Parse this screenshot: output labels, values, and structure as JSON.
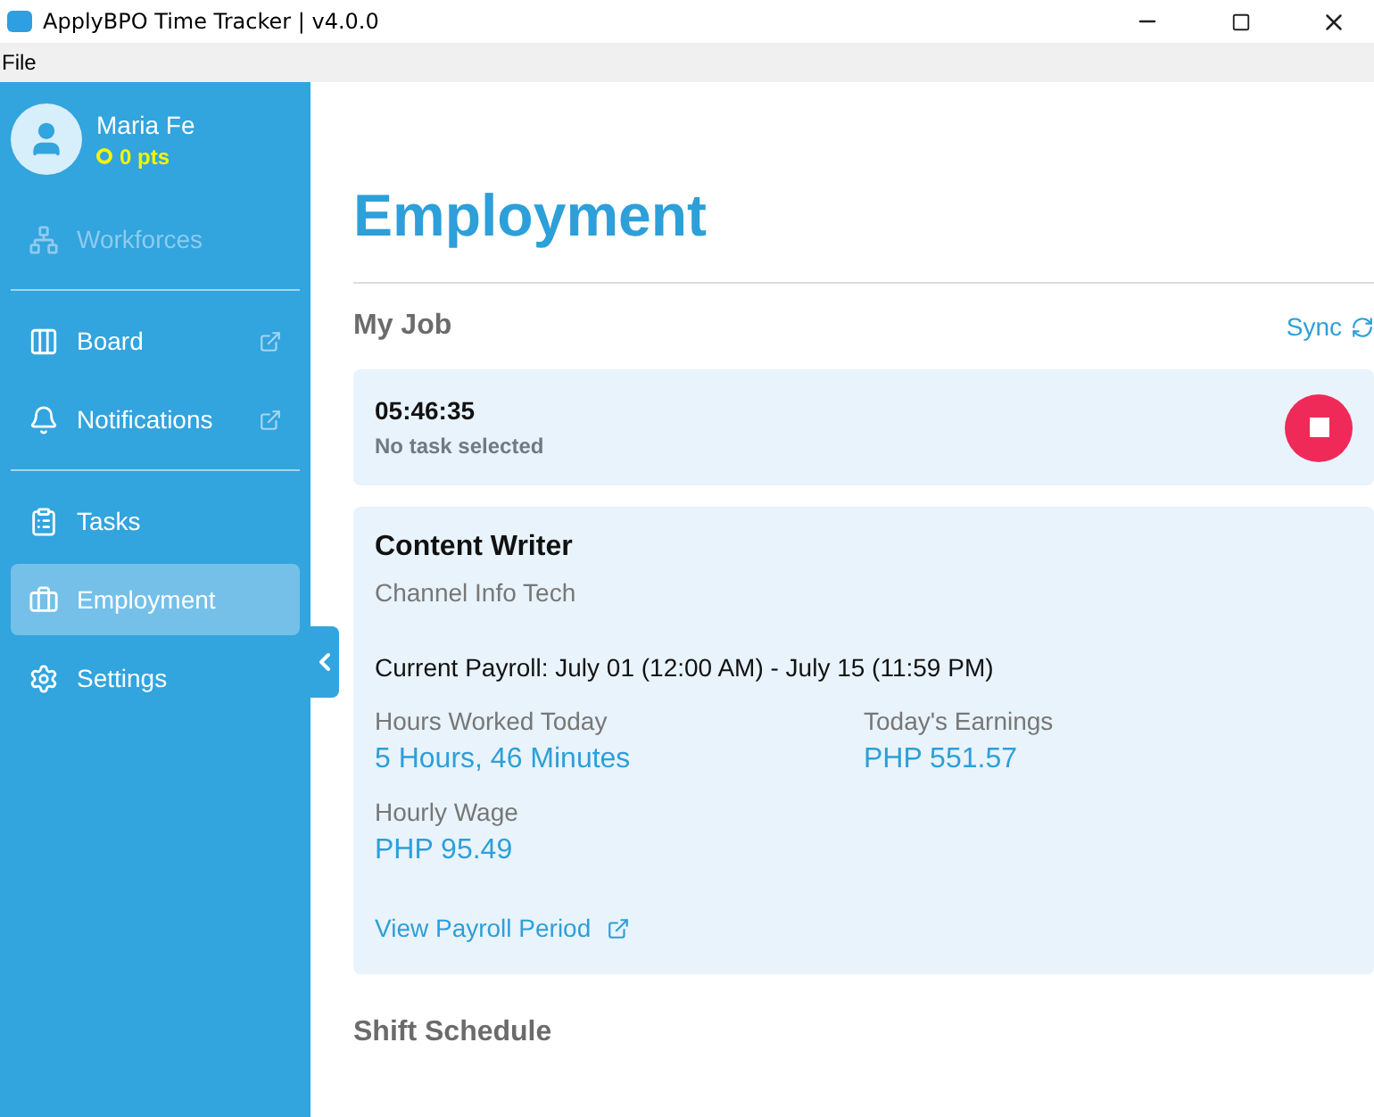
{
  "window": {
    "title": "ApplyBPO Time Tracker | v4.0.0"
  },
  "menu": [
    "File"
  ],
  "user": {
    "name": "Maria Fe",
    "points": "0 pts"
  },
  "nav_groups": [
    [
      {
        "label": "Workforces",
        "disabled": true,
        "selected": false,
        "external": false
      }
    ],
    [
      {
        "label": "Board",
        "disabled": false,
        "selected": false,
        "external": true
      },
      {
        "label": "Notifications",
        "disabled": false,
        "selected": false,
        "external": true
      }
    ],
    [
      {
        "label": "Tasks",
        "disabled": false,
        "selected": false,
        "external": false
      },
      {
        "label": "Employment",
        "disabled": false,
        "selected": true,
        "external": false
      },
      {
        "label": "Settings",
        "disabled": false,
        "selected": false,
        "external": false
      }
    ]
  ],
  "page": {
    "title": "Employment",
    "section": "My Job",
    "sync": "Sync"
  },
  "timer": {
    "time": "05:46:35",
    "task": "No task selected",
    "running": true
  },
  "job": {
    "title": "Content Writer",
    "company": "Channel Info Tech",
    "payroll": "Current Payroll: July 01 (12:00 AM) - July 15 (11:59 PM)",
    "stats": [
      {
        "label": "Hours Worked Today",
        "value": "5 Hours, 46 Minutes"
      },
      {
        "label": "Today's Earnings",
        "value": "PHP 551.57"
      },
      {
        "label": "Hourly Wage",
        "value": "PHP 95.49"
      }
    ],
    "link": "View Payroll Period"
  },
  "next_section": "Shift Schedule"
}
